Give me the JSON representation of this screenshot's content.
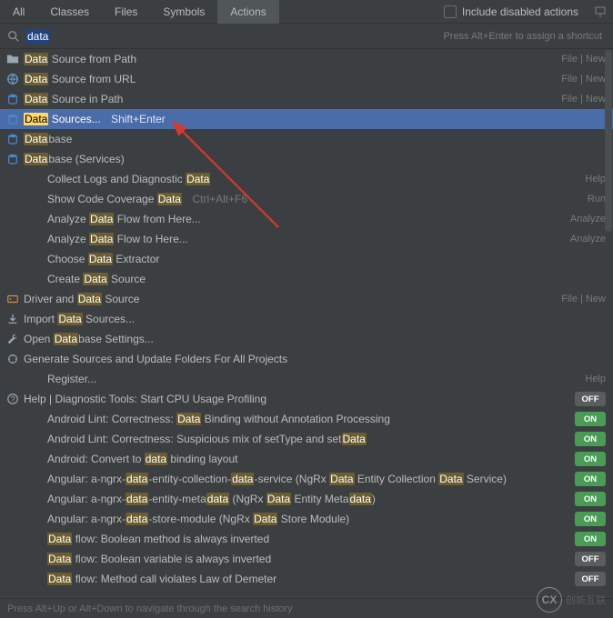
{
  "tabs": {
    "items": [
      "All",
      "Classes",
      "Files",
      "Symbols",
      "Actions"
    ],
    "active_index": 4,
    "checkbox_label": "Include disabled actions"
  },
  "search": {
    "value": "data",
    "hint": "Press Alt+Enter to assign a shortcut"
  },
  "results": [
    {
      "icon": "folder",
      "label": "Data Source from Path",
      "right": "File | New"
    },
    {
      "icon": "url",
      "label": "Data Source from URL",
      "right": "File | New"
    },
    {
      "icon": "db",
      "label": "Data Source in Path",
      "right": "File | New"
    },
    {
      "icon": "db-blue",
      "label": "Data Sources...",
      "shortcut": "Shift+Enter",
      "selected": true
    },
    {
      "icon": "db",
      "label": "Database"
    },
    {
      "icon": "db",
      "label": "Database (Services)"
    },
    {
      "icon": "",
      "label": "Collect Logs and Diagnostic Data",
      "right": "Help",
      "indent": true
    },
    {
      "icon": "",
      "label": "Show Code Coverage Data",
      "shortcut": "Ctrl+Alt+F6",
      "right": "Run",
      "indent": true
    },
    {
      "icon": "",
      "label": "Analyze Data Flow from Here...",
      "right": "Analyze",
      "indent": true
    },
    {
      "icon": "",
      "label": "Analyze Data Flow to Here...",
      "right": "Analyze",
      "indent": true
    },
    {
      "icon": "",
      "label": "Choose Data Extractor",
      "indent": true
    },
    {
      "icon": "",
      "label": "Create Data Source",
      "indent": true
    },
    {
      "icon": "driver",
      "label": "Driver and Data Source",
      "right": "File | New"
    },
    {
      "icon": "import",
      "label": "Import Data Sources..."
    },
    {
      "icon": "wrench",
      "label": "Open Database Settings..."
    },
    {
      "icon": "gen",
      "label": "Generate Sources and Update Folders For All Projects"
    },
    {
      "icon": "",
      "label": "Register...",
      "right": "Help",
      "indent": true
    },
    {
      "icon": "help",
      "label": "Help | Diagnostic Tools: Start CPU Usage Profiling",
      "toggle": "OFF"
    },
    {
      "icon": "",
      "label": "Android Lint: Correctness: Data Binding without Annotation Processing",
      "toggle": "ON",
      "indent": true
    },
    {
      "icon": "",
      "label": "Android Lint: Correctness: Suspicious mix of setType and setData",
      "toggle": "ON",
      "indent": true
    },
    {
      "icon": "",
      "label": "Android: Convert to data binding layout",
      "toggle": "ON",
      "indent": true
    },
    {
      "icon": "",
      "label": "Angular: a-ngrx-data-entity-collection-data-service (NgRx Data Entity Collection Data Service)",
      "toggle": "ON",
      "indent": true
    },
    {
      "icon": "",
      "label": "Angular: a-ngrx-data-entity-metadata (NgRx Data Entity Metadata)",
      "toggle": "ON",
      "indent": true
    },
    {
      "icon": "",
      "label": "Angular: a-ngrx-data-store-module (NgRx Data Store Module)",
      "toggle": "ON",
      "indent": true
    },
    {
      "icon": "",
      "label": "Data flow: Boolean method is always inverted",
      "toggle": "ON",
      "indent": true
    },
    {
      "icon": "",
      "label": "Data flow: Boolean variable is always inverted",
      "toggle": "OFF",
      "indent": true
    },
    {
      "icon": "",
      "label": "Data flow: Method call violates Law of Demeter",
      "toggle": "OFF",
      "indent": true
    }
  ],
  "footer": {
    "hint": "Press Alt+Up or Alt+Down to navigate through the search history"
  },
  "watermark": {
    "text": "创新互联",
    "logo": "CX"
  },
  "colors": {
    "selection": "#4a6ca8",
    "highlight": "#ffd86b",
    "toggle_on": "#499c54"
  }
}
